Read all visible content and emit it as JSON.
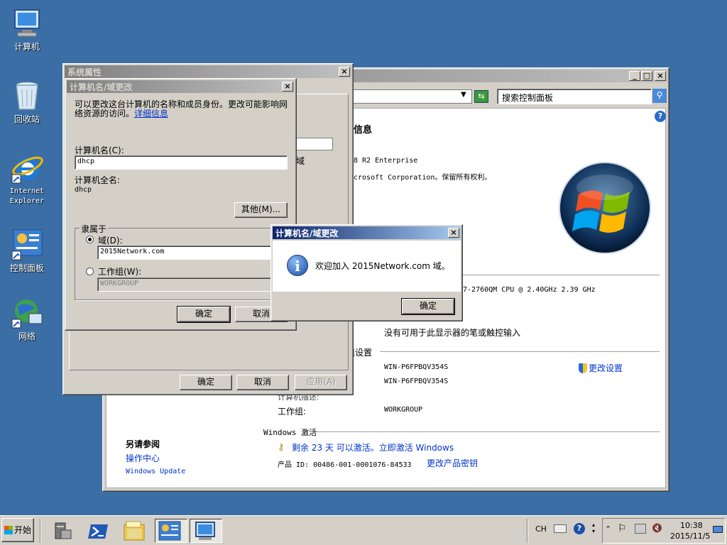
{
  "desktop": {
    "icons": [
      {
        "label": "计算机"
      },
      {
        "label": "回收站"
      },
      {
        "label": "Internet Explorer"
      },
      {
        "label": "控制面板"
      },
      {
        "label": "网络"
      }
    ]
  },
  "control_panel": {
    "search_placeholder": "搜索控制面板",
    "heading_fragment": "本信息",
    "edition_fragment": "8 R2 Enterprise",
    "copyright_fragment": "crosoft Corporation。保留所有权利。",
    "cpu_fragment": "i7-2760QM CPU @ 2.40GHz   2.39 GHz",
    "pen_touch": "没有可用于此显示器的笔或触控输入",
    "section_settings": "组设置",
    "computer_name": "WIN-P6FPBQV354S",
    "full_name": "WIN-P6FPBQV354S",
    "desc_fragment": "计算机描述:",
    "workgroup_label": "工作组:",
    "workgroup_value": "WORKGROUP",
    "change_settings": "更改设置",
    "activation_title": "Windows 激活",
    "activation_text": "剩余 23 天 可以激活。立即激活 Windows",
    "product_id_label": "产品 ID: 00486-001-0001076-84533",
    "change_key": "更改产品密钥",
    "see_also": "另请参阅",
    "action_center": "操作中心",
    "windows_update": "Windows Update"
  },
  "system_properties": {
    "title": "系统属性",
    "ok": "确定",
    "cancel": "取消",
    "apply": "应用(A)",
    "behind_text": "域"
  },
  "computer_name_dialog": {
    "title": "计算机名/域更改",
    "description": "可以更改这台计算机的名称和成员身份。更改可能影响网络资源的访问。",
    "details_link": "详细信息",
    "name_label": "计算机名(C):",
    "name_value": "dhcp",
    "full_name_label": "计算机全名:",
    "full_name_value": "dhcp",
    "more_button": "其他(M)...",
    "member_of": "隶属于",
    "domain_label": "域(D):",
    "domain_value": "2015Network.com",
    "workgroup_label": "工作组(W):",
    "workgroup_value": "WORKGROUP",
    "ok": "确定",
    "cancel": "取消"
  },
  "welcome_dialog": {
    "title": "计算机名/域更改",
    "message": "欢迎加入 2015Network.com 域。",
    "ok": "确定"
  },
  "taskbar": {
    "start": "开始",
    "lang": "CH",
    "time": "10:38",
    "date": "2015/11/5"
  }
}
